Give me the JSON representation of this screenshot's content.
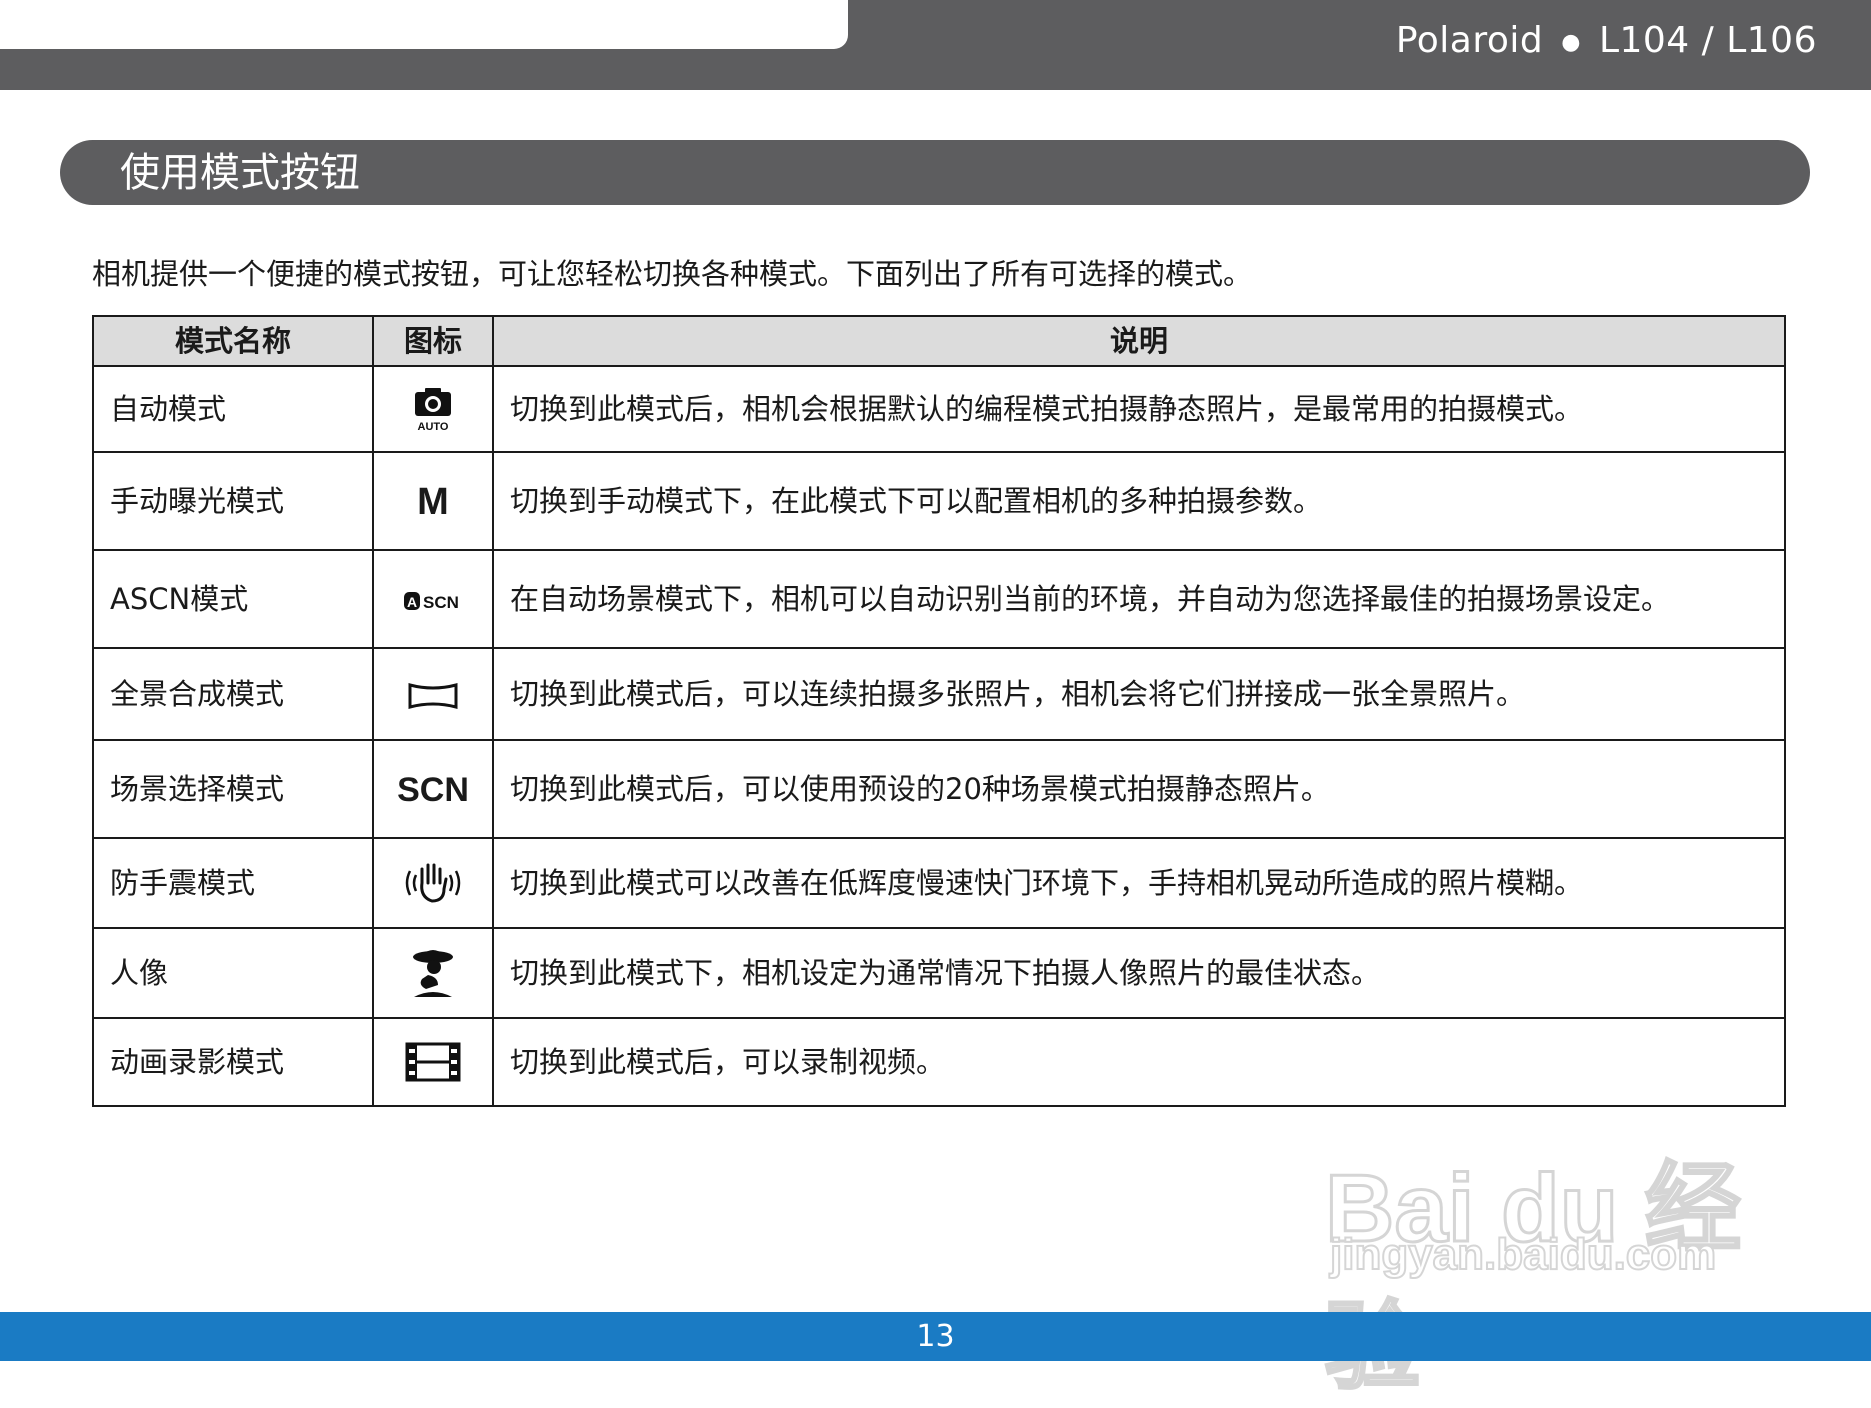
{
  "header": {
    "brand": "Polaroid",
    "bullet": "●",
    "model": "L104 / L106"
  },
  "section": {
    "title": "使用模式按钮"
  },
  "intro": "相机提供一个便捷的模式按钮，可让您轻松切换各种模式。下面列出了所有可选择的模式。",
  "table": {
    "headers": [
      "模式名称",
      "图标",
      "说明"
    ],
    "rows": [
      {
        "name": "自动模式",
        "icon": "camera-auto-icon",
        "icon_label": "AUTO",
        "desc": "切换到此模式后，相机会根据默认的编程模式拍摄静态照片，是最常用的拍摄模式。"
      },
      {
        "name": "手动曝光模式",
        "icon": "manual-m-icon",
        "icon_label": "M",
        "desc": "切换到手动模式下，在此模式下可以配置相机的多种拍摄参数。"
      },
      {
        "name": "ASCN模式",
        "icon": "ascn-icon",
        "icon_label": "ASCN",
        "desc": "在自动场景模式下，相机可以自动识别当前的环境，并自动为您选择最佳的拍摄场景设定。"
      },
      {
        "name": "全景合成模式",
        "icon": "panorama-icon",
        "icon_label": "",
        "desc": "切换到此模式后，可以连续拍摄多张照片，相机会将它们拼接成一张全景照片。"
      },
      {
        "name": "场景选择模式",
        "icon": "scn-icon",
        "icon_label": "SCN",
        "desc": "切换到此模式后，可以使用预设的20种场景模式拍摄静态照片。"
      },
      {
        "name": "防手震模式",
        "icon": "anti-shake-hand-icon",
        "icon_label": "",
        "desc": "切换到此模式可以改善在低辉度慢速快门环境下，手持相机晃动所造成的照片模糊。"
      },
      {
        "name": "人像",
        "icon": "portrait-icon",
        "icon_label": "",
        "desc": "切换到此模式下，相机设定为通常情况下拍摄人像照片的最佳状态。"
      },
      {
        "name": "动画录影模式",
        "icon": "movie-film-icon",
        "icon_label": "",
        "desc": "切换到此模式后，可以录制视频。"
      }
    ]
  },
  "watermark": {
    "brand": "Bai du 经验",
    "url": "jingyan.baidu.com"
  },
  "footer": {
    "page_number": "13"
  },
  "colors": {
    "header_bg": "#5d5d5f",
    "table_header_bg": "#dcdcdc",
    "footer_bg": "#1a7bc4"
  }
}
